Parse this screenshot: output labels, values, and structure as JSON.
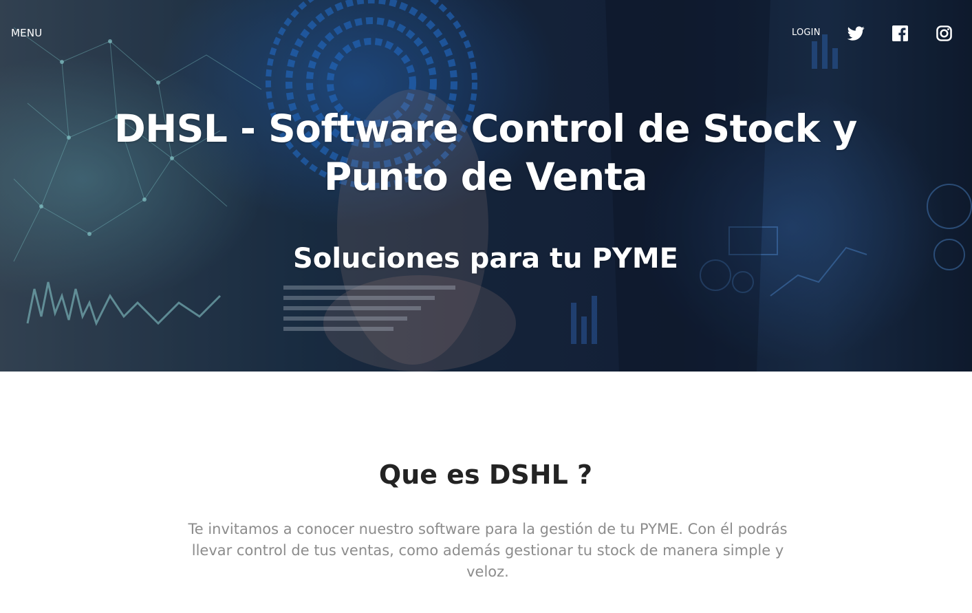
{
  "nav": {
    "menu_label": "MENU",
    "login_label": "LOGIN",
    "social": [
      {
        "name": "twitter",
        "icon": "twitter-icon"
      },
      {
        "name": "facebook",
        "icon": "facebook-icon"
      },
      {
        "name": "instagram",
        "icon": "instagram-icon"
      }
    ]
  },
  "hero": {
    "title": "DHSL - Software Control de Stock y Punto de Venta",
    "subtitle": "Soluciones para tu PYME"
  },
  "about": {
    "heading": "Que es DSHL ?",
    "text": "Te invitamos a conocer nuestro software para la gestión de tu PYME. Con él podrás llevar control de tus ventas, como además gestionar tu stock de manera simple y veloz."
  },
  "colors": {
    "hero_text": "#ffffff",
    "heading": "#232323",
    "body_text": "#8c8c8c",
    "hero_accent": "#2a6fd6"
  }
}
